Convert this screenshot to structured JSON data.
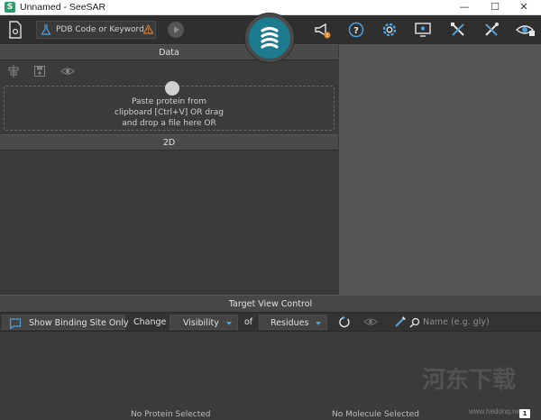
{
  "window": {
    "icon_letter": "S",
    "title": "Unnamed - SeeSAR",
    "min": "—",
    "max": "☐",
    "close": "✕"
  },
  "toolbar": {
    "search_text": "PDB Code or Keyword",
    "accent": "#1c7b8e",
    "icons": [
      "document-icon",
      "flask-icon",
      "warning-icon",
      "play-icon",
      "seesar-logo",
      "megaphone-icon",
      "help-icon",
      "settings-icon",
      "display-icon",
      "tools-icon",
      "molecule-tools-icon",
      "view-icon"
    ]
  },
  "data_section": {
    "header": "Data",
    "dropzone_lines": [
      "Paste protein from",
      "clipboard [Ctrl+V] OR drag",
      "and drop a file here OR"
    ]
  },
  "section_2d": {
    "header": "2D"
  },
  "target_view": {
    "header": "Target View Control",
    "show_binding_site": "Show Binding Site Only",
    "change": "Change",
    "visibility": "Visibility",
    "of": "of",
    "residues": "Residues",
    "name_placeholder": "Name (e.g. gly)"
  },
  "status": {
    "protein": "No Protein Selected",
    "molecule": "No Molecule Selected",
    "chat_count": "1"
  },
  "watermark": {
    "text": "河东下载",
    "url": "www.hedonq.net"
  }
}
